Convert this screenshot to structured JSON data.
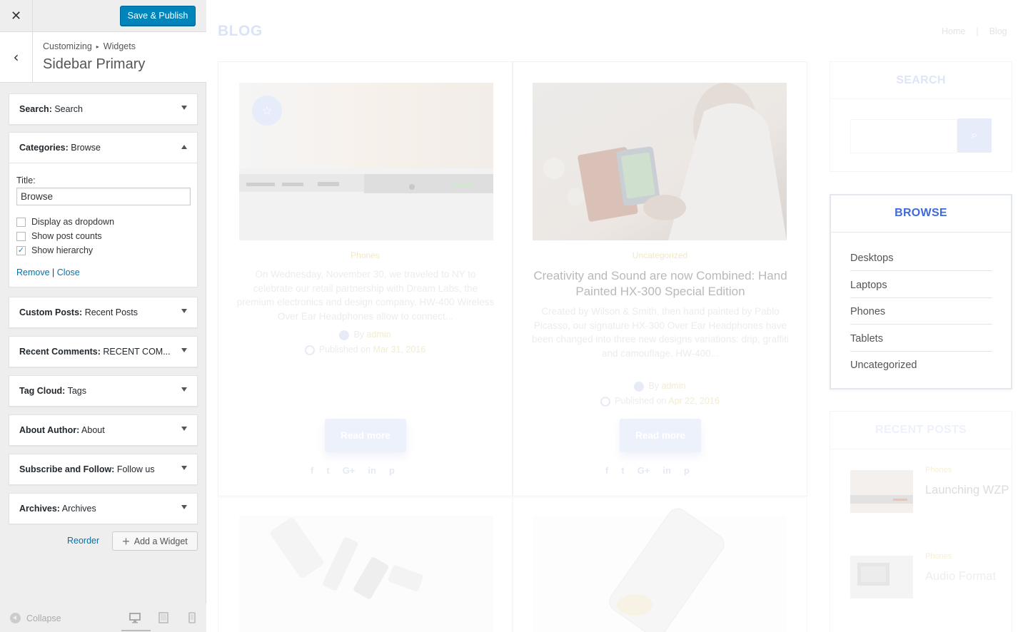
{
  "customizer": {
    "publish_label": "Save & Publish",
    "breadcrumb_root": "Customizing",
    "breadcrumb_current": "Widgets",
    "section_title": "Sidebar Primary",
    "widgets": [
      {
        "type": "Search:",
        "title": "Search"
      },
      {
        "type": "Categories:",
        "title": "Browse"
      },
      {
        "type": "Custom Posts:",
        "title": "Recent Posts"
      },
      {
        "type": "Recent Comments:",
        "title": "RECENT COM..."
      },
      {
        "type": "Tag Cloud:",
        "title": "Tags"
      },
      {
        "type": "About Author:",
        "title": "About"
      },
      {
        "type": "Subscribe and Follow:",
        "title": "Follow us"
      },
      {
        "type": "Archives:",
        "title": "Archives"
      }
    ],
    "categories_form": {
      "title_label": "Title:",
      "title_value": "Browse",
      "options": [
        {
          "label": "Display as dropdown",
          "checked": false
        },
        {
          "label": "Show post counts",
          "checked": false
        },
        {
          "label": "Show hierarchy",
          "checked": true
        }
      ],
      "remove_label": "Remove",
      "separator": "|",
      "close_label": "Close"
    },
    "reorder_label": "Reorder",
    "add_widget_label": "Add a Widget",
    "collapse_label": "Collapse"
  },
  "preview": {
    "blog_title": "BLOG",
    "nav": [
      "Home",
      "|",
      "Blog"
    ],
    "posts": [
      {
        "category": "Phones",
        "title": "",
        "excerpt": "On Wednesday, November 30, we traveled to NY to celebrate our retail partnership with Dream Labs, the premium electronics and design company. HW-400 Wireless Over Ear Headphones allow to connect...",
        "author_prefix": "By",
        "author": "admin",
        "date_prefix": "Published on",
        "date": "Mar 31, 2016",
        "read_more": "Read more"
      },
      {
        "category": "Uncategorized",
        "title": "Creativity and Sound are now Combined: Hand Painted HX-300 Special Edition",
        "excerpt": "Created by Wilson & Smith, then hand painted by Pablo Picasso, our signature HX-300 Over Ear Headphones have been changed into three new designs variations: drip, graffiti and camouflage. HW-400...",
        "author_prefix": "By",
        "author": "admin",
        "date_prefix": "Published on",
        "date": "Apr 22, 2016",
        "read_more": "Read more"
      }
    ],
    "social_icons": [
      "facebook-icon",
      "twitter-icon",
      "google-plus-icon",
      "linkedin-icon",
      "pinterest-icon"
    ],
    "social_glyphs": [
      "f",
      "t",
      "G+",
      "in",
      "p"
    ],
    "sidebar": {
      "search_title": "SEARCH",
      "browse_title": "BROWSE",
      "browse_items": [
        "Desktops",
        "Laptops",
        "Phones",
        "Tablets",
        "Uncategorized"
      ],
      "recent_title": "RECENT POSTS",
      "recent_posts": [
        {
          "category": "Phones",
          "title": "Launching WZP"
        },
        {
          "category": "Phones",
          "title": "Audio Format"
        }
      ]
    },
    "colors": {
      "accent": "#3f6ad8",
      "publish": "#0085ba",
      "link": "#0073aa"
    }
  }
}
